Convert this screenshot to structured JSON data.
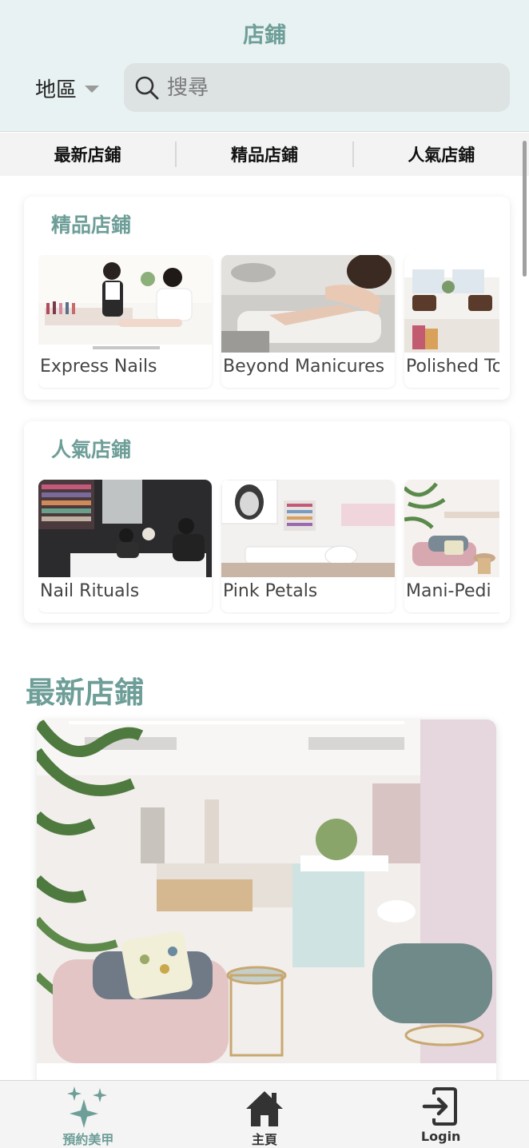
{
  "header": {
    "title": "店鋪",
    "region_label": "地區",
    "search_placeholder": "搜尋"
  },
  "tabs": [
    {
      "label": "最新店鋪"
    },
    {
      "label": "精品店鋪"
    },
    {
      "label": "人氣店鋪"
    }
  ],
  "boutique": {
    "title": "精品店鋪",
    "stores": [
      {
        "name": "Express Nails"
      },
      {
        "name": "Beyond Manicures"
      },
      {
        "name": "Polished To"
      }
    ]
  },
  "popular": {
    "title": "人氣店鋪",
    "stores": [
      {
        "name": "Nail Rituals"
      },
      {
        "name": "Pink Petals"
      },
      {
        "name": "Mani-Pedi"
      }
    ]
  },
  "latest": {
    "title": "最新店鋪"
  },
  "bottom_nav": [
    {
      "label": "預約美甲",
      "icon": "sparkle-icon",
      "active": true
    },
    {
      "label": "主頁",
      "icon": "home-icon",
      "active": false
    },
    {
      "label": "Login",
      "icon": "login-icon",
      "active": false
    }
  ],
  "colors": {
    "accent": "#6e9e98",
    "header_bg": "#e9f2f2"
  }
}
